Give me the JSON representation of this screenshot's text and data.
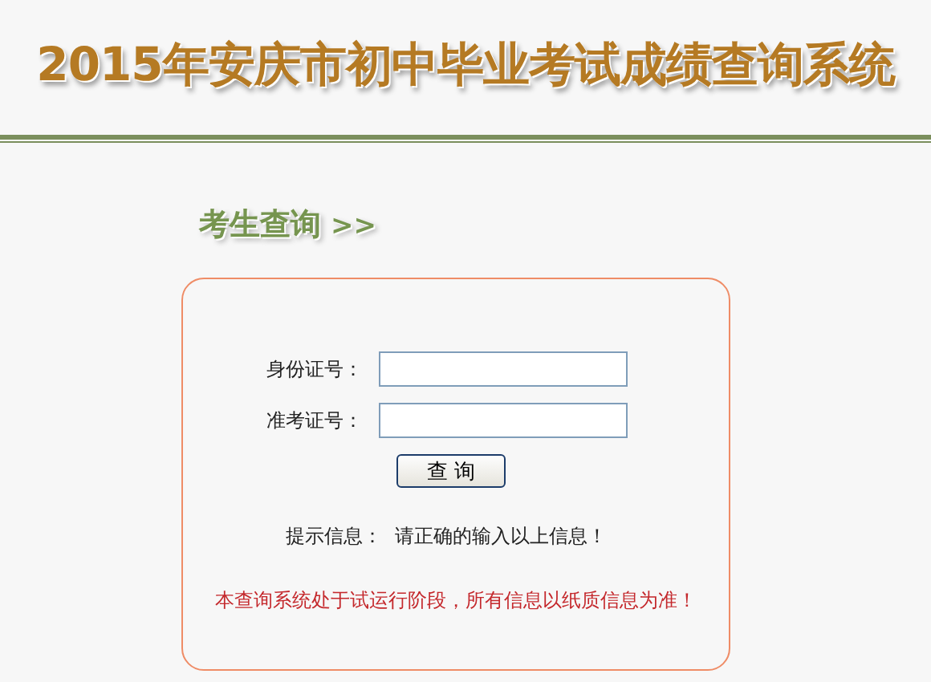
{
  "header": {
    "title": "2015年安庆市初中毕业考试成绩查询系统"
  },
  "section": {
    "title": "考生查询",
    "arrows": ">>"
  },
  "form": {
    "fields": [
      {
        "label": "身份证号："
      },
      {
        "label": "准考证号："
      }
    ],
    "submit": "查 询",
    "hint": {
      "label": "提示信息：",
      "text": "请正确的输入以上信息！"
    },
    "notice": "本查询系统处于试运行阶段，所有信息以纸质信息为准！"
  }
}
